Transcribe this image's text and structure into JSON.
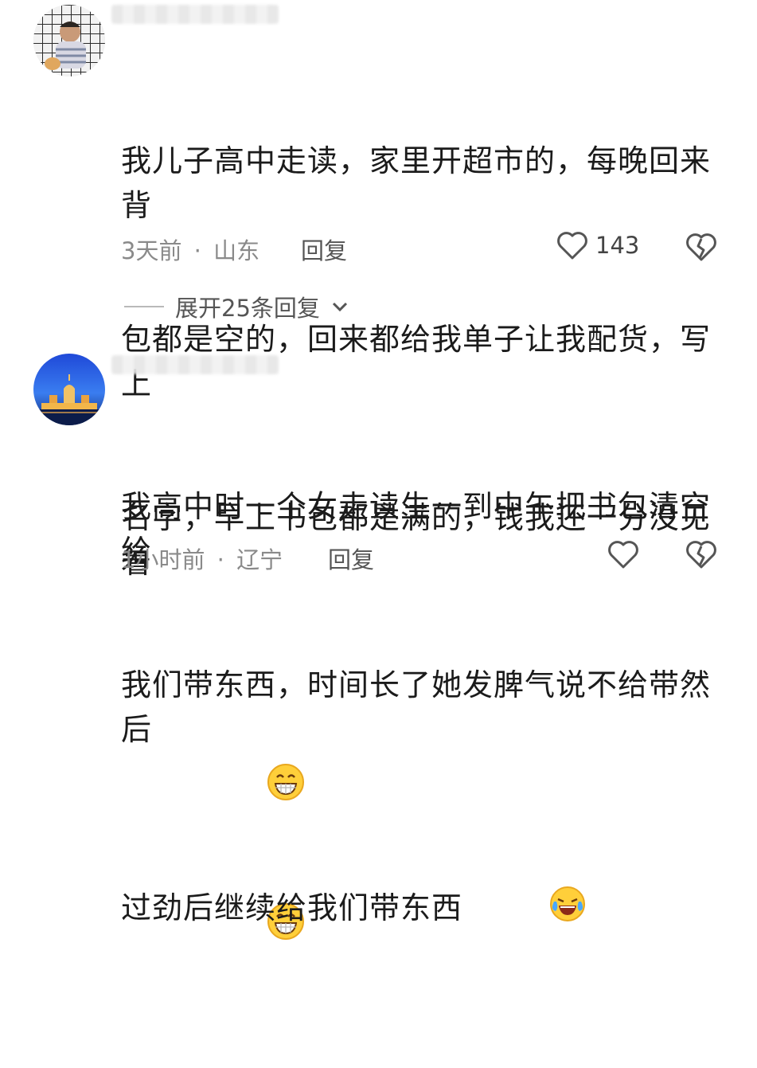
{
  "comments": [
    {
      "text_lines": [
        "我儿子高中走读，家里开超市的，每晚回来背",
        "包都是空的，回来都给我单子让我配货，写上",
        "名字，早上书包都是满的，钱我还一分没见着"
      ],
      "emoji": "grin-face-icon",
      "time": "3天前",
      "location": "山东",
      "reply_label": "回复",
      "like_count": "143",
      "expand_label": "展开25条回复"
    },
    {
      "text_lines": [
        "我高中时一个女走读生一到中午把书包清空给",
        "我们带东西，时间长了她发脾气说不给带然后",
        "过劲后继续给我们带东西"
      ],
      "emoji": "laugh-cry-face-icon",
      "time": "1小时前",
      "location": "辽宁",
      "reply_label": "回复",
      "like_count": ""
    }
  ],
  "separator": "·"
}
